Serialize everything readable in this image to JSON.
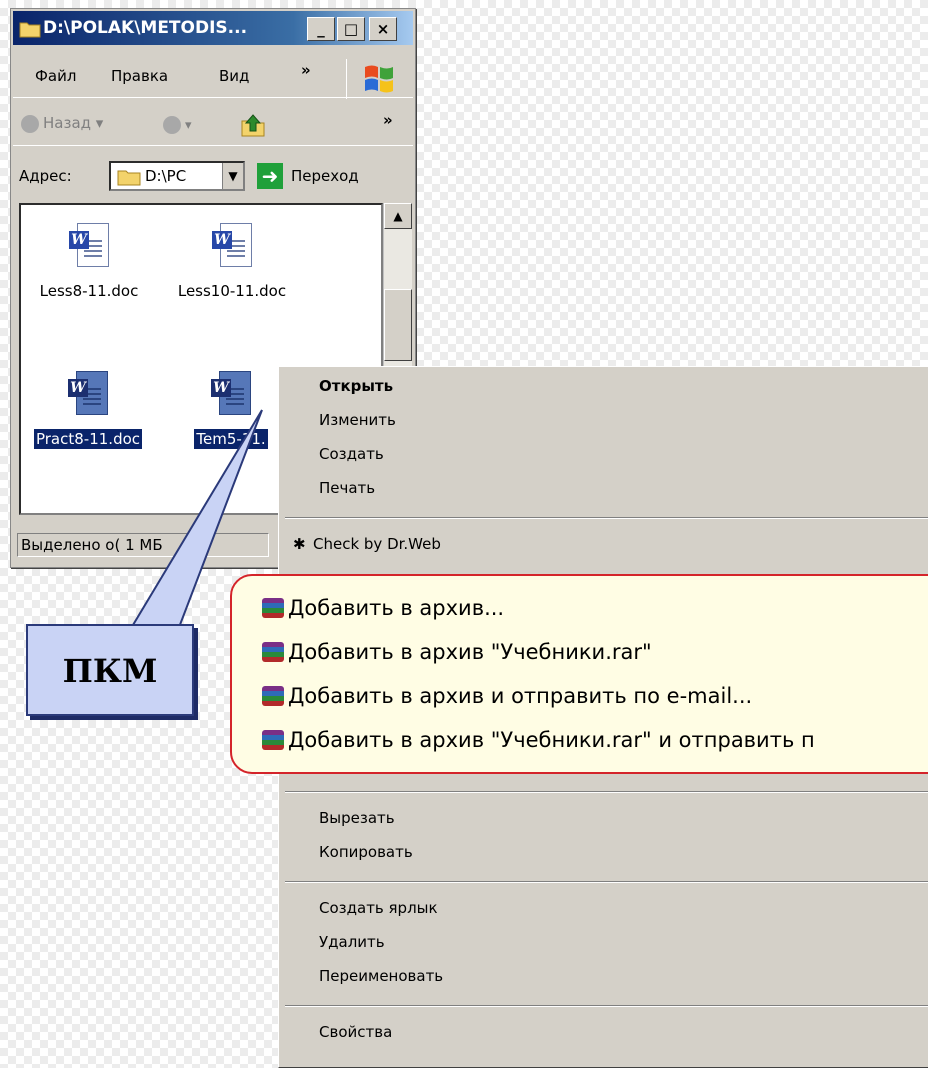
{
  "window": {
    "title": "D:\\POLAK\\METODIS...",
    "controls": {
      "minimize": "_",
      "maximize": "□",
      "close": "×"
    }
  },
  "menubar": {
    "file": "Файл",
    "edit": "Правка",
    "view": "Вид",
    "more": "»"
  },
  "toolbar": {
    "back": "Назад",
    "more": "»"
  },
  "address": {
    "label": "Адрес:",
    "value": "D:\\PC",
    "go": "Переход"
  },
  "files": [
    {
      "name": "Less8-11.doc",
      "selected": false
    },
    {
      "name": "Less10-11.doc",
      "selected": false
    },
    {
      "name": "Pract8-11.doc",
      "selected": true
    },
    {
      "name": "Tem5-11.",
      "selected": true
    }
  ],
  "status": {
    "text": "Выделено о( 1 МБ"
  },
  "context_menu": {
    "open": "Открыть",
    "edit": "Изменить",
    "create": "Создать",
    "print": "Печать",
    "drweb": "Check by Dr.Web",
    "cut": "Вырезать",
    "copy": "Копировать",
    "shortcut": "Создать ярлык",
    "delete": "Удалить",
    "rename": "Переименовать",
    "properties": "Свойства"
  },
  "archive_items": [
    "Добавить в архив...",
    "Добавить в архив \"Учебники.rar\"",
    "Добавить в архив и отправить по e-mail...",
    "Добавить в архив \"Учебники.rar\" и отправить п"
  ],
  "callout": {
    "label": "ПКМ"
  },
  "icons": {
    "folder": "folder-icon",
    "windows": "windows-logo-icon",
    "back": "back-arrow-icon",
    "forward": "forward-arrow-icon",
    "up": "up-folder-icon",
    "go": "go-arrow-icon",
    "doc": "word-document-icon",
    "drweb": "drweb-spider-icon",
    "rar": "winrar-icon"
  },
  "colors": {
    "selection": "#0a246a",
    "highlight_border": "#d4242a",
    "callout_fill": "#c9d3f5"
  }
}
